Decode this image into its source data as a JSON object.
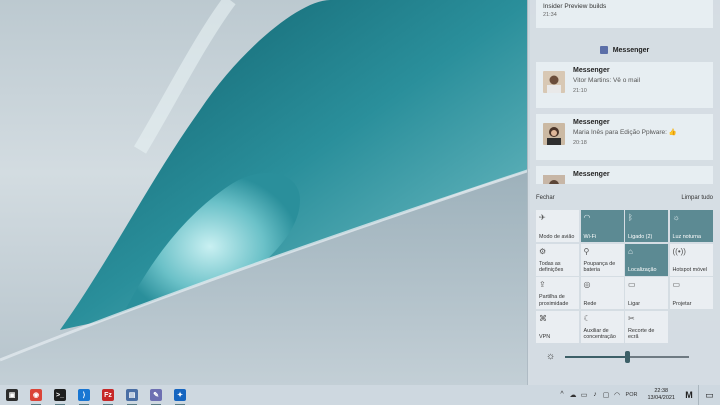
{
  "wallpaper": {
    "description_icon": "wave-wallpaper"
  },
  "action_center": {
    "top_notification": {
      "body": "Insider Preview builds",
      "time": "21:34"
    },
    "group": {
      "app": "Messenger",
      "icon": "messenger-icon"
    },
    "notifications": [
      {
        "app": "Messenger",
        "message": "Vitor Martins: Vê o mail",
        "time": "21:10"
      },
      {
        "app": "Messenger",
        "message": "Maria Inês para Edição Pplware: 👍",
        "time": "20:18"
      },
      {
        "app": "Messenger"
      }
    ],
    "close_label": "Fechar",
    "clear_all_label": "Limpar tudo",
    "tiles": [
      {
        "label": "Modo de avião",
        "icon": "airplane-icon",
        "glyph": "✈",
        "on": false
      },
      {
        "label": "Wi-Fi",
        "icon": "wifi-icon",
        "glyph": "◠",
        "on": true
      },
      {
        "label": "Ligado (2)",
        "icon": "bluetooth-icon",
        "glyph": "ᛒ",
        "on": true
      },
      {
        "label": "Luz noturna",
        "icon": "night-light-icon",
        "glyph": "☼",
        "on": true
      },
      {
        "label": "Todas as definições",
        "icon": "settings-icon",
        "glyph": "⚙",
        "on": false
      },
      {
        "label": "Poupança de bateria",
        "icon": "battery-saver-icon",
        "glyph": "⚲",
        "on": false
      },
      {
        "label": "Localização",
        "icon": "location-icon",
        "glyph": "⌂",
        "on": true
      },
      {
        "label": "Hotspot móvel",
        "icon": "hotspot-icon",
        "glyph": "((•))",
        "on": false
      },
      {
        "label": "Partilha de proximidade",
        "icon": "nearby-share-icon",
        "glyph": "⇪",
        "on": false
      },
      {
        "label": "Rede",
        "icon": "network-icon",
        "glyph": "◎",
        "on": false
      },
      {
        "label": "Ligar",
        "icon": "connect-icon",
        "glyph": "▭",
        "on": false
      },
      {
        "label": "Projetar",
        "icon": "project-icon",
        "glyph": "▭",
        "on": false
      },
      {
        "label": "VPN",
        "icon": "vpn-icon",
        "glyph": "⌘",
        "on": false
      },
      {
        "label": "Auxiliar de concentração",
        "icon": "focus-assist-icon",
        "glyph": "☾",
        "on": false
      },
      {
        "label": "Recorte de ecrã",
        "icon": "snip-icon",
        "glyph": "✂",
        "on": false
      }
    ],
    "brightness_level": 0.5
  },
  "taskbar": {
    "apps": [
      {
        "name": "store-icon",
        "color": "#2d2d2d",
        "glyph": "▣"
      },
      {
        "name": "chrome-icon",
        "color": "#db4437",
        "glyph": "◉"
      },
      {
        "name": "terminal-icon",
        "color": "#1e1e1e",
        "glyph": ">_"
      },
      {
        "name": "vscode-icon",
        "color": "#1976d2",
        "glyph": "⟩"
      },
      {
        "name": "filezilla-icon",
        "color": "#c62828",
        "glyph": "Fz"
      },
      {
        "name": "remote-desktop-icon",
        "color": "#4a6fa5",
        "glyph": "▤"
      },
      {
        "name": "snipping-tool-icon",
        "color": "#6d6fb2",
        "glyph": "✎"
      },
      {
        "name": "feedback-hub-icon",
        "color": "#1565c0",
        "glyph": "✦"
      }
    ],
    "tray": {
      "icons": [
        {
          "name": "chevron-up-icon",
          "glyph": "^"
        },
        {
          "name": "cloud-icon",
          "glyph": "☁"
        },
        {
          "name": "battery-icon",
          "glyph": "▭"
        },
        {
          "name": "volume-icon",
          "glyph": "♪"
        },
        {
          "name": "display-icon",
          "glyph": "▢"
        },
        {
          "name": "wifi-tray-icon",
          "glyph": "◠"
        }
      ],
      "language": "POR",
      "time": "22:38",
      "date": "13/04/2021",
      "logo": "M",
      "notification_glyph": "▭"
    }
  }
}
